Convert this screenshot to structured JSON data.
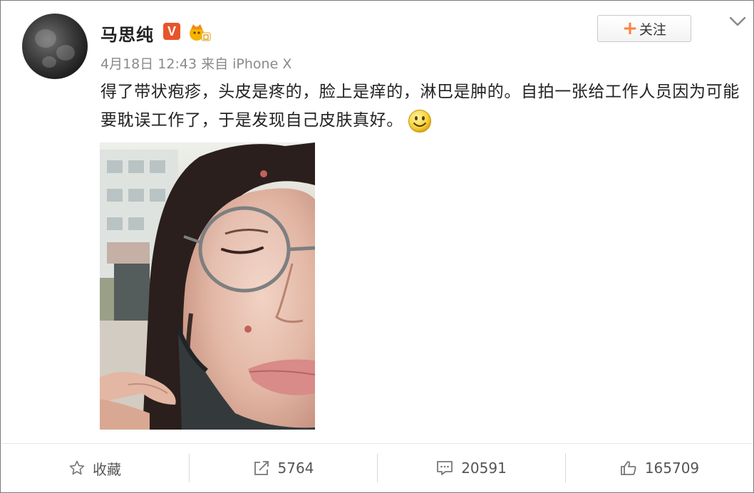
{
  "user": {
    "name": "马思纯",
    "verified_badge": "V"
  },
  "post": {
    "meta": "4月18日 12:43 来自 iPhone X",
    "text": "得了带状疱疹，头皮是疼的，脸上是痒的，淋巴是肿的。自拍一张给工作人员因为可能要耽误工作了，于是发现自己皮肤真好。"
  },
  "follow_button": {
    "label": "关注"
  },
  "actions": {
    "favorite_label": "收藏",
    "repost_count": "5764",
    "comment_count": "20591",
    "like_count": "165709"
  },
  "colors": {
    "accent": "#ff8140",
    "verified": "#e8542a"
  },
  "icons": [
    "star-icon",
    "repost-icon",
    "comment-icon",
    "like-icon",
    "chevron-down-icon",
    "smiley-emoji"
  ]
}
